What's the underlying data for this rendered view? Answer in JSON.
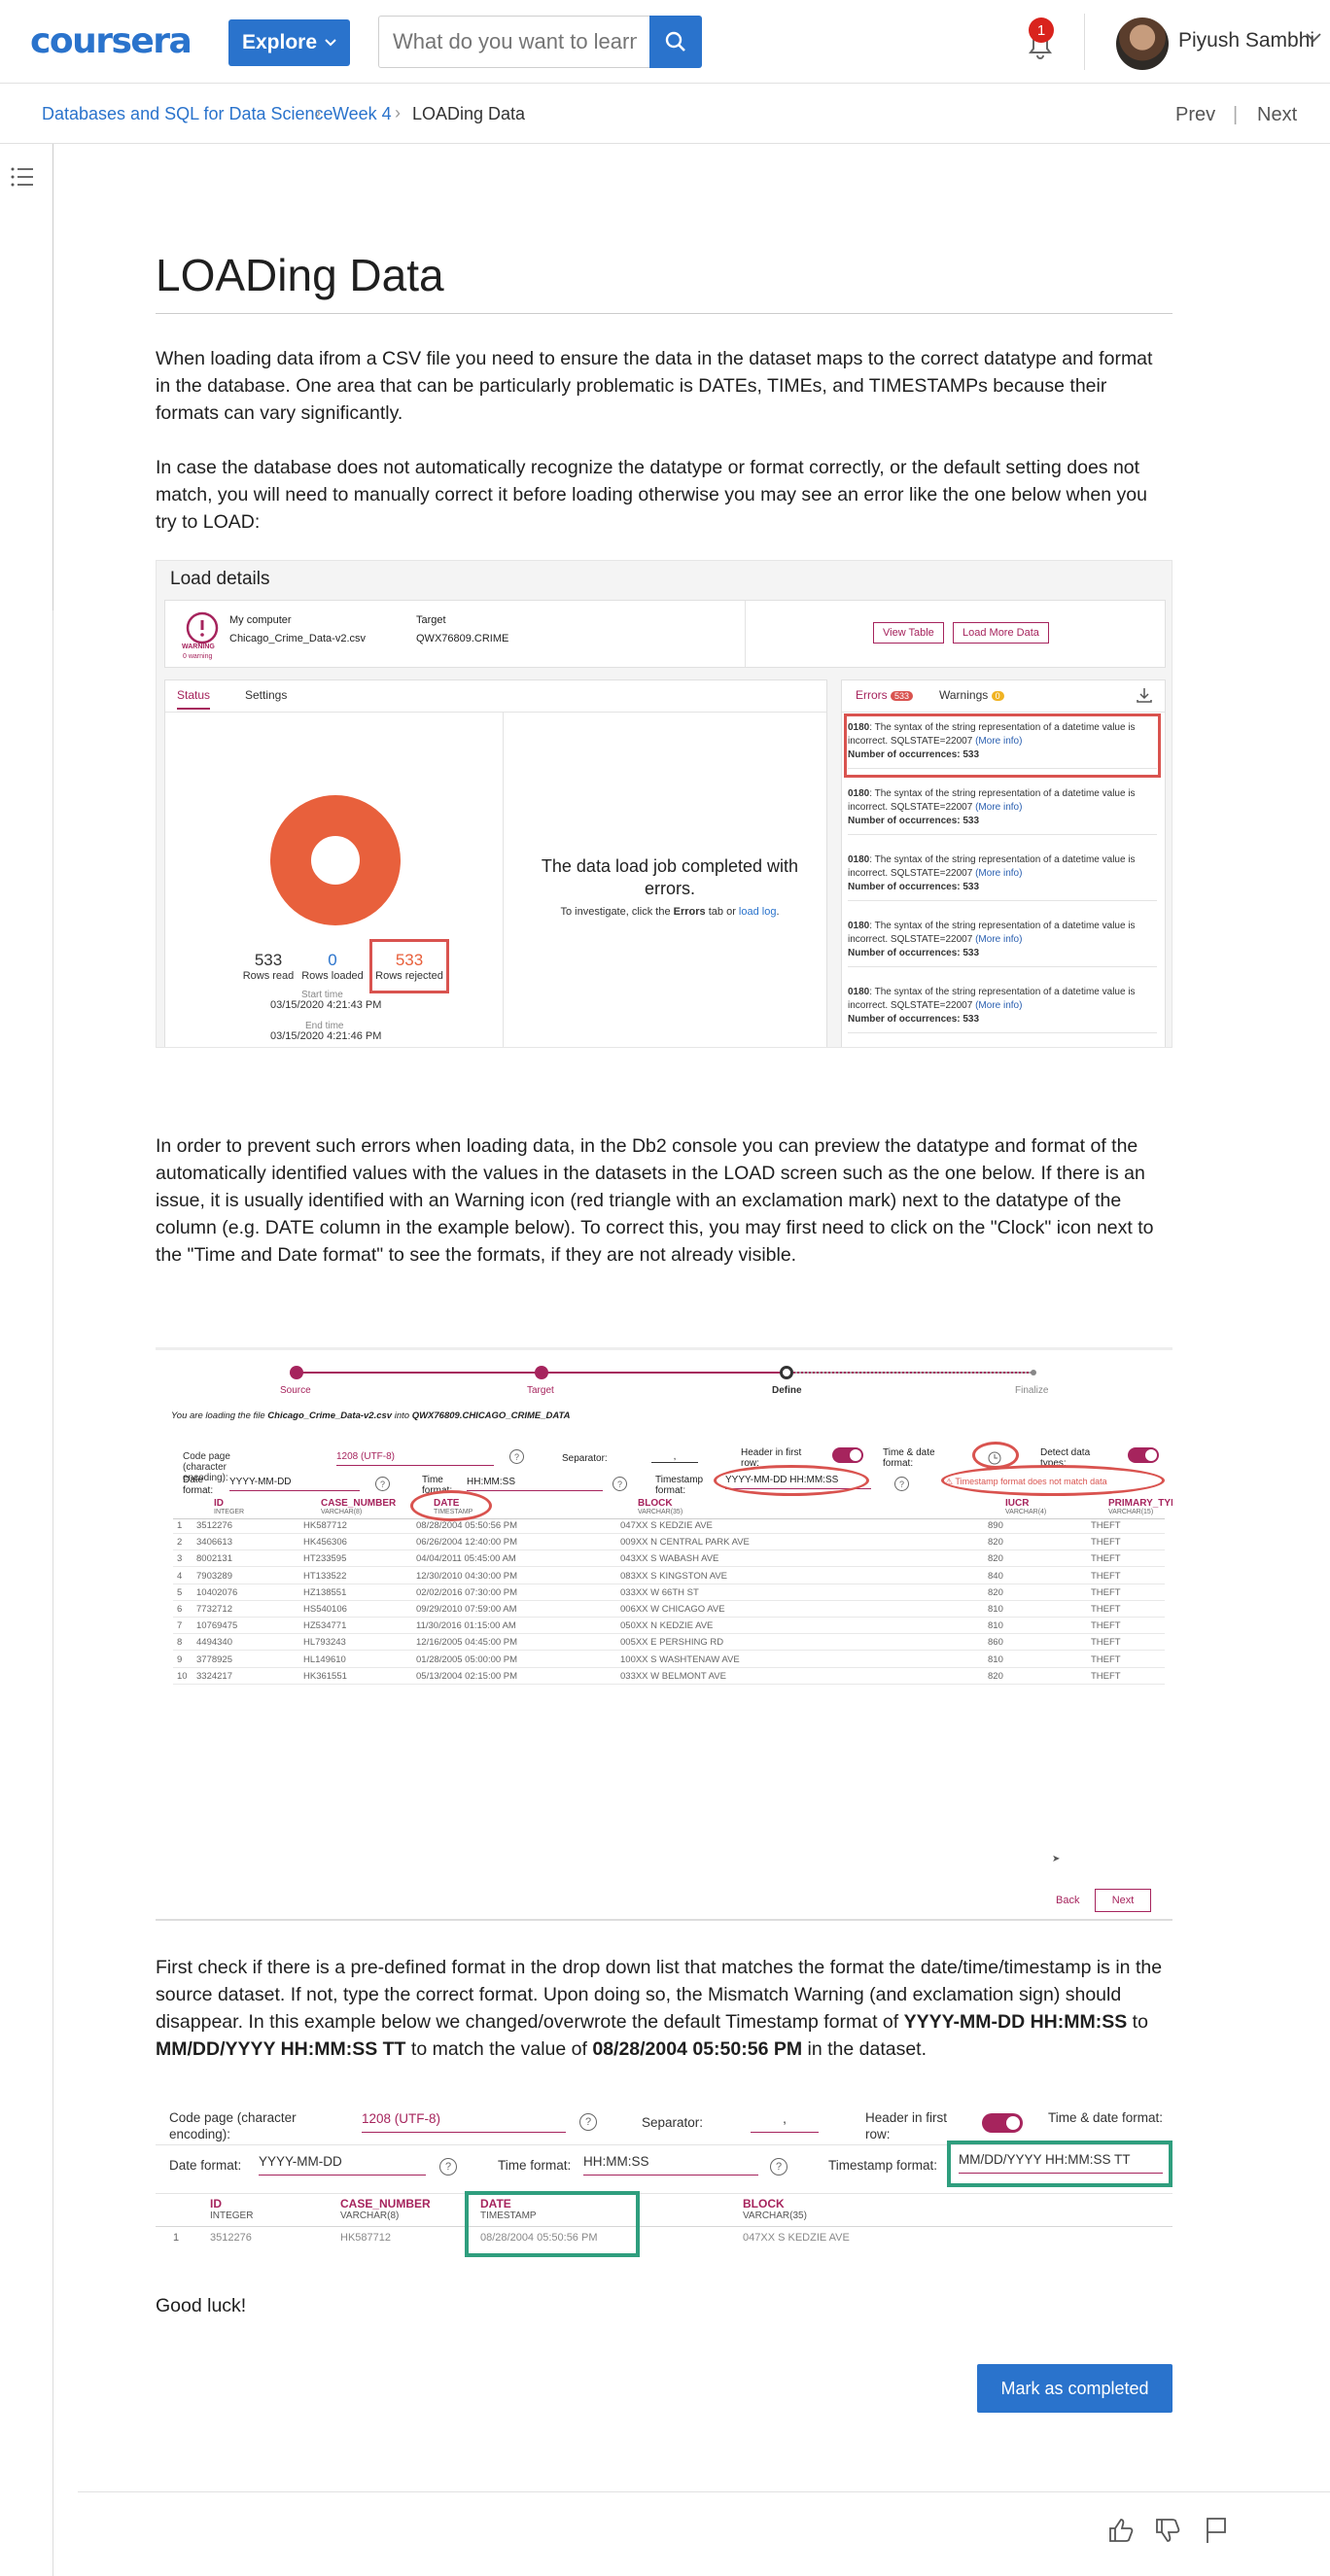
{
  "header": {
    "logo": "coursera",
    "explore_label": "Explore",
    "search_placeholder": "What do you want to learn?",
    "notification_count": "1",
    "user_name": "Piyush Sambhi"
  },
  "breadcrumb": {
    "course": "Databases and SQL for Data Science",
    "week": "Week 4",
    "current": "LOADing Data",
    "prev": "Prev",
    "next": "Next"
  },
  "page": {
    "title": "LOADing Data",
    "para1": "When loading data ifrom a CSV file you need to ensure the data in the dataset maps to the correct datatype and format in the database. One area that can be particularly problematic is DATEs, TIMEs, and TIMESTAMPs because their formats can vary significantly.",
    "para2": "In case the database does not automatically recognize the datatype or format correctly, or the default setting does not match, you will need to manually correct it before loading otherwise you may see an error like the one below when you try to LOAD:",
    "para3": "In order to prevent such errors when loading data, in the Db2 console you can preview the datatype and format of the automatically identified values with the values in the datasets in the LOAD screen such as the one below. If there is an issue, it is usually identified with an Warning icon (red triangle with an exclamation mark) next to the datatype of the column (e.g. DATE column in the example below). To correct this, you may first need to click on the \"Clock\" icon next to the \"Time and Date format\" to see the formats, if they are not already visible.",
    "para4_a": "First check if there is a pre-defined format in the drop down list that matches the format the date/time/timestamp is in the source dataset. If not, type the correct format. Upon doing so, the Mismatch Warning (and exclamation sign) should disappear. In this example below we changed/overwrote the default Timestamp format of ",
    "para4_b": "YYYY-MM-DD HH:MM:SS",
    "para4_c": " to ",
    "para4_d": "MM/DD/YYYY HH:MM:SS TT",
    "para4_e": " to match the value of ",
    "para4_f": "08/28/2004 05:50:56 PM",
    "para4_g": " in the dataset.",
    "closing": "Good luck!",
    "mark_completed": "Mark as completed"
  },
  "figure1": {
    "title": "Load details",
    "warning_label": "WARNING",
    "warning_sub": "0 warning",
    "source_label": "My computer",
    "source_file": "Chicago_Crime_Data-v2.csv",
    "target_label": "Target",
    "target_table": "QWX76809.CRIME",
    "view_table": "View Table",
    "load_more": "Load More Data",
    "tab_status": "Status",
    "tab_settings": "Settings",
    "rows_read": "533",
    "rows_read_label": "Rows read",
    "rows_loaded": "0",
    "rows_loaded_label": "Rows loaded",
    "rows_rejected": "533",
    "rows_rejected_label": "Rows rejected",
    "start_label": "Start time",
    "start_time": "03/15/2020 4:21:43 PM",
    "end_label": "End time",
    "end_time": "03/15/2020 4:21:46 PM",
    "completed_msg": "The data load job completed with errors.",
    "investigate_a": "To investigate, click the ",
    "investigate_b": "Errors",
    "investigate_c": " tab or ",
    "investigate_d": "load log",
    "investigate_e": ".",
    "errors_tab": "Errors",
    "errors_count": "533",
    "warnings_tab": "Warnings",
    "warnings_count": "0",
    "error_code": "0180",
    "error_text": ": The syntax of the string representation of a datetime value is incorrect. SQLSTATE=22007 ",
    "more_info": "(More info)",
    "occurrences": "Number of occurrences: 533"
  },
  "figure2": {
    "steps": [
      "Source",
      "Target",
      "Define",
      "Finalize"
    ],
    "loading_a": "You are loading the file ",
    "loading_file": "Chicago_Crime_Data-v2.csv",
    "loading_b": " into ",
    "loading_table": "QWX76809.CHICAGO_CRIME_DATA",
    "code_page_label": "Code page (character encoding):",
    "code_page": "1208 (UTF-8)",
    "separator_label": "Separator:",
    "separator": ",",
    "header_label": "Header in first row:",
    "timedate_label": "Time & date format:",
    "detect_label": "Detect data types:",
    "date_format_label": "Date format:",
    "date_format": "YYYY-MM-DD",
    "time_format_label": "Time format:",
    "time_format": "HH:MM:SS",
    "timestamp_format_label": "Timestamp format:",
    "timestamp_format": "YYYY-MM-DD HH:MM:SS",
    "mismatch": "Timestamp format does not match data",
    "columns": [
      {
        "name": "ID",
        "type": "INTEGER"
      },
      {
        "name": "CASE_NUMBER",
        "type": "VARCHAR(8)"
      },
      {
        "name": "DATE",
        "type": "TIMESTAMP"
      },
      {
        "name": "BLOCK",
        "type": "VARCHAR(35)"
      },
      {
        "name": "IUCR",
        "type": "VARCHAR(4)"
      },
      {
        "name": "PRIMARY_TYPE",
        "type": "VARCHAR(15)"
      }
    ],
    "rows": [
      [
        "1",
        "3512276",
        "HK587712",
        "08/28/2004 05:50:56 PM",
        "047XX S KEDZIE AVE",
        "890",
        "THEFT"
      ],
      [
        "2",
        "3406613",
        "HK456306",
        "06/26/2004 12:40:00 PM",
        "009XX N CENTRAL PARK AVE",
        "820",
        "THEFT"
      ],
      [
        "3",
        "8002131",
        "HT233595",
        "04/04/2011 05:45:00 AM",
        "043XX S WABASH AVE",
        "820",
        "THEFT"
      ],
      [
        "4",
        "7903289",
        "HT133522",
        "12/30/2010 04:30:00 PM",
        "083XX S KINGSTON AVE",
        "840",
        "THEFT"
      ],
      [
        "5",
        "10402076",
        "HZ138551",
        "02/02/2016 07:30:00 PM",
        "033XX W 66TH ST",
        "820",
        "THEFT"
      ],
      [
        "6",
        "7732712",
        "HS540106",
        "09/29/2010 07:59:00 AM",
        "006XX W CHICAGO AVE",
        "810",
        "THEFT"
      ],
      [
        "7",
        "10769475",
        "HZ534771",
        "11/30/2016 01:15:00 AM",
        "050XX N KEDZIE AVE",
        "810",
        "THEFT"
      ],
      [
        "8",
        "4494340",
        "HL793243",
        "12/16/2005 04:45:00 PM",
        "005XX E PERSHING RD",
        "860",
        "THEFT"
      ],
      [
        "9",
        "3778925",
        "HL149610",
        "01/28/2005 05:00:00 PM",
        "100XX S WASHTENAW AVE",
        "810",
        "THEFT"
      ],
      [
        "10",
        "3324217",
        "HK361551",
        "05/13/2004 02:15:00 PM",
        "033XX W BELMONT AVE",
        "820",
        "THEFT"
      ]
    ],
    "back": "Back",
    "next": "Next"
  },
  "figure3": {
    "code_page_label": "Code page (character encoding):",
    "code_page": "1208 (UTF-8)",
    "separator_label": "Separator:",
    "separator": ",",
    "header_label": "Header in first row:",
    "timedate_label": "Time & date format:",
    "date_format_label": "Date format:",
    "date_format": "YYYY-MM-DD",
    "time_format_label": "Time format:",
    "time_format": "HH:MM:SS",
    "timestamp_format_label": "Timestamp format:",
    "timestamp_format": "MM/DD/YYYY HH:MM:SS TT",
    "columns": [
      {
        "name": "ID",
        "type": "INTEGER"
      },
      {
        "name": "CASE_NUMBER",
        "type": "VARCHAR(8)"
      },
      {
        "name": "DATE",
        "type": "TIMESTAMP"
      },
      {
        "name": "BLOCK",
        "type": "VARCHAR(35)"
      }
    ],
    "row": [
      "1",
      "3512276",
      "HK587712",
      "08/28/2004 05:50:56 PM",
      "047XX S KEDZIE AVE"
    ]
  },
  "colors": {
    "accent": "#2a73cc",
    "pink": "#a6245d",
    "error_red": "#d9534f",
    "green": "#2f9e7e",
    "donut": "#e8603c"
  }
}
